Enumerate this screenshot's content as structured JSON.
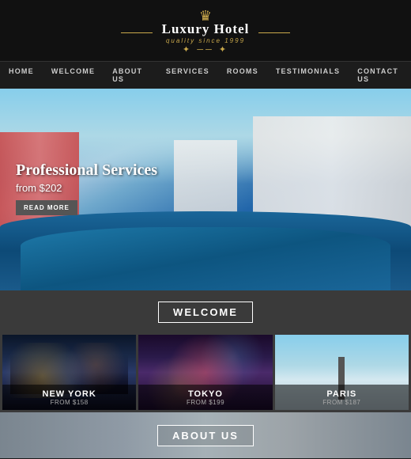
{
  "header": {
    "logo_crown": "♛",
    "logo_ornament_top": "✦ ── ✦",
    "logo_main": "Luxury Hotel",
    "logo_sub": "quality since 1999",
    "logo_ornament_bottom": "✦ ── ✦"
  },
  "nav": {
    "items": [
      {
        "label": "HOME"
      },
      {
        "label": "WELCOME"
      },
      {
        "label": "ABOUT US"
      },
      {
        "label": "SERVICES"
      },
      {
        "label": "ROOMS"
      },
      {
        "label": "TESTIMONIALS"
      },
      {
        "label": "CONTACT US"
      }
    ]
  },
  "hero": {
    "title": "Professional Services",
    "price": "from $202",
    "button": "READ MORE"
  },
  "welcome": {
    "title": "WELCOME"
  },
  "cities": [
    {
      "name": "NEW YORK",
      "price": "FROM $158"
    },
    {
      "name": "TOKYO",
      "price": "FROM $199"
    },
    {
      "name": "PARIS",
      "price": "FROM $187"
    }
  ],
  "about": {
    "title": "ABOUT US"
  }
}
